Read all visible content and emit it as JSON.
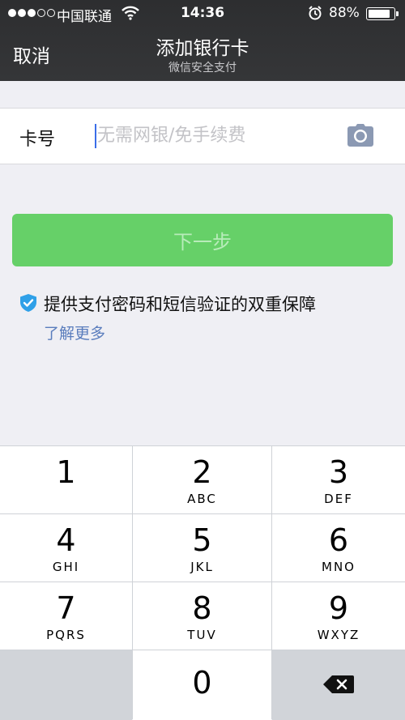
{
  "status_bar": {
    "carrier": "中国联通",
    "time": "14:36",
    "battery": "88%",
    "battery_level": 0.88
  },
  "nav": {
    "cancel_label": "取消",
    "title": "添加银行卡",
    "subtitle": "微信安全支付"
  },
  "card_field": {
    "label": "卡号",
    "value": "",
    "placeholder": "无需网银/免手续费"
  },
  "next_button": {
    "label": "下一步",
    "color": "#66d068"
  },
  "security": {
    "text": "提供支付密码和短信验证的双重保障",
    "learn_more": "了解更多",
    "shield_color": "#2fa0e8"
  },
  "keypad": {
    "keys": [
      {
        "num": "1",
        "letters": ""
      },
      {
        "num": "2",
        "letters": "ABC"
      },
      {
        "num": "3",
        "letters": "DEF"
      },
      {
        "num": "4",
        "letters": "GHI"
      },
      {
        "num": "5",
        "letters": "JKL"
      },
      {
        "num": "6",
        "letters": "MNO"
      },
      {
        "num": "7",
        "letters": "PQRS"
      },
      {
        "num": "8",
        "letters": "TUV"
      },
      {
        "num": "9",
        "letters": "WXYZ"
      },
      {
        "num": "0",
        "letters": ""
      }
    ],
    "delete_icon": "backspace-icon"
  },
  "icons": {
    "camera": "camera-icon",
    "shield": "shield-check-icon",
    "wifi": "wifi-icon",
    "alarm": "alarm-icon"
  }
}
